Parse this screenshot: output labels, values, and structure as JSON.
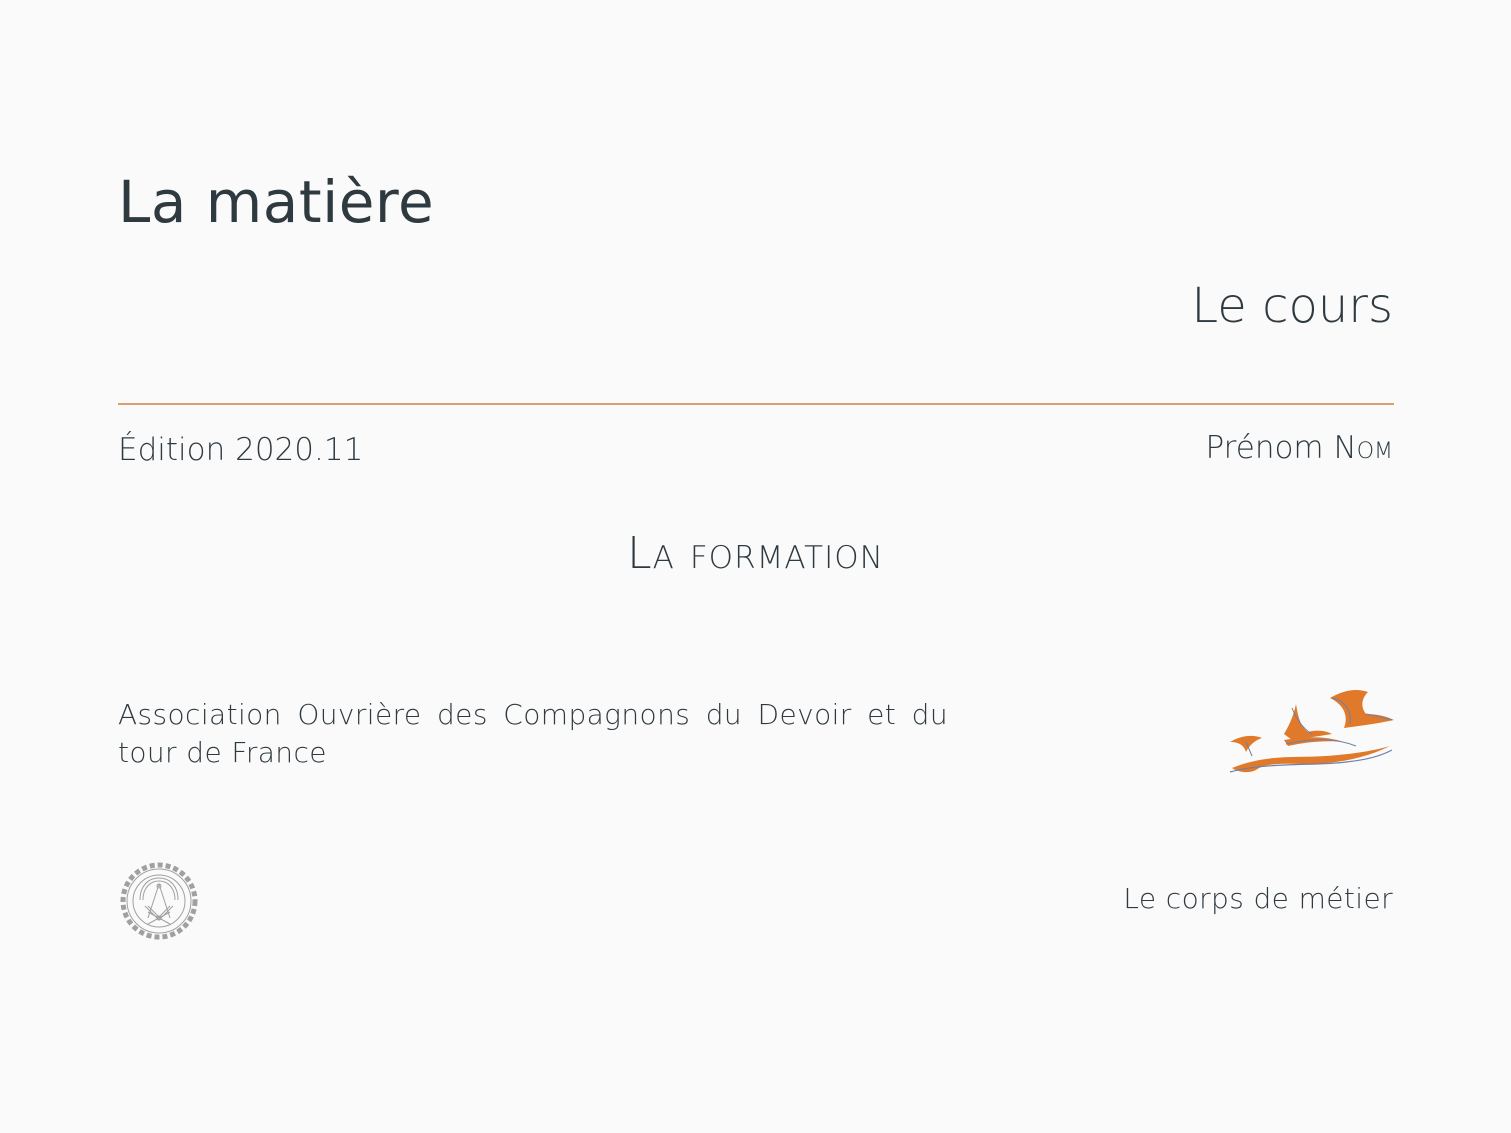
{
  "title": "La matière",
  "subtitle": "Le cours",
  "edition": "Édition 2020.11",
  "author": {
    "first_name": "Prénom",
    "last_name": "Nom"
  },
  "course": "La formation",
  "institution": "Association Ouvrière des Compagnons du Devoir et du tour de France",
  "trade": "Le corps de métier",
  "colors": {
    "text": "#2f3a40",
    "accent": "#d9a06d",
    "logo_orange": "#e07a2a",
    "logo_blue": "#6f7fa8",
    "emblem_gray": "#a0a0a0"
  },
  "icons": {
    "logo": "birds-logo-icon",
    "emblem": "compagnons-emblem-icon"
  }
}
